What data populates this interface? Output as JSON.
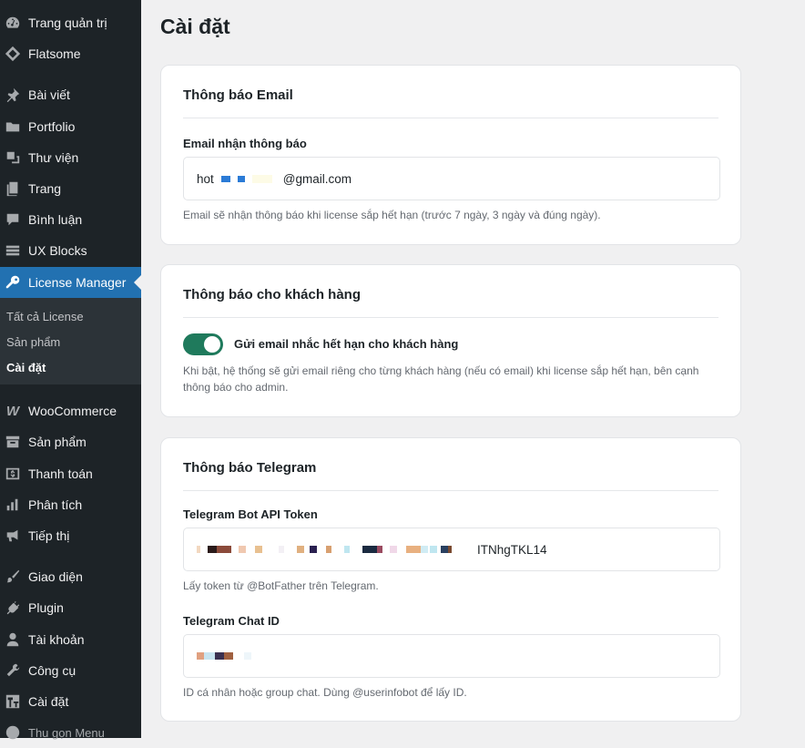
{
  "sidebar": {
    "items": [
      {
        "label": "Trang quản trị",
        "icon": "dashboard-icon"
      },
      {
        "label": "Flatsome",
        "icon": "flatsome-icon"
      },
      {
        "label": "Bài viết",
        "icon": "pin-icon"
      },
      {
        "label": "Portfolio",
        "icon": "folder-icon"
      },
      {
        "label": "Thư viện",
        "icon": "media-icon"
      },
      {
        "label": "Trang",
        "icon": "page-icon"
      },
      {
        "label": "Bình luận",
        "icon": "comment-icon"
      },
      {
        "label": "UX Blocks",
        "icon": "blocks-icon"
      },
      {
        "label": "License Manager",
        "icon": "key-icon"
      },
      {
        "label": "WooCommerce",
        "icon": "woocommerce-icon"
      },
      {
        "label": "Sản phẩm",
        "icon": "archive-icon"
      },
      {
        "label": "Thanh toán",
        "icon": "payment-icon"
      },
      {
        "label": "Phân tích",
        "icon": "chart-bar-icon"
      },
      {
        "label": "Tiếp thị",
        "icon": "megaphone-icon"
      },
      {
        "label": "Giao diện",
        "icon": "brush-icon"
      },
      {
        "label": "Plugin",
        "icon": "plugin-icon"
      },
      {
        "label": "Tài khoản",
        "icon": "user-icon"
      },
      {
        "label": "Công cụ",
        "icon": "wrench-icon"
      },
      {
        "label": "Cài đặt",
        "icon": "settings-icon"
      }
    ],
    "submenu": [
      "Tất cả License",
      "Sản phẩm",
      "Cài đặt"
    ],
    "collapse_label": "Thu gọn Menu"
  },
  "page": {
    "title": "Cài đặt"
  },
  "email_card": {
    "title": "Thông báo Email",
    "field_label": "Email nhận thông báo",
    "value_prefix": "hot",
    "value_suffix": "@gmail.com",
    "help": "Email sẽ nhận thông báo khi license sắp hết hạn (trước 7 ngày, 3 ngày và đúng ngày)."
  },
  "customer_card": {
    "title": "Thông báo cho khách hàng",
    "toggle_label": "Gửi email nhắc hết hạn cho khách hàng",
    "toggle_on": true,
    "help": "Khi bật, hệ thống sẽ gửi email riêng cho từng khách hàng (nếu có email) khi license sắp hết hạn, bên cạnh thông báo cho admin."
  },
  "telegram_card": {
    "title": "Thông báo Telegram",
    "token_label": "Telegram Bot API Token",
    "token_visible_suffix": "ITNhgTKL14",
    "token_help": "Lấy token từ @BotFather trên Telegram.",
    "chat_label": "Telegram Chat ID",
    "chat_help": "ID cá nhân hoặc group chat. Dùng @userinfobot để lấy ID."
  },
  "colors": {
    "sidebar_bg": "#1d2327",
    "active": "#2271b1",
    "toggle": "#1f7a5c"
  }
}
